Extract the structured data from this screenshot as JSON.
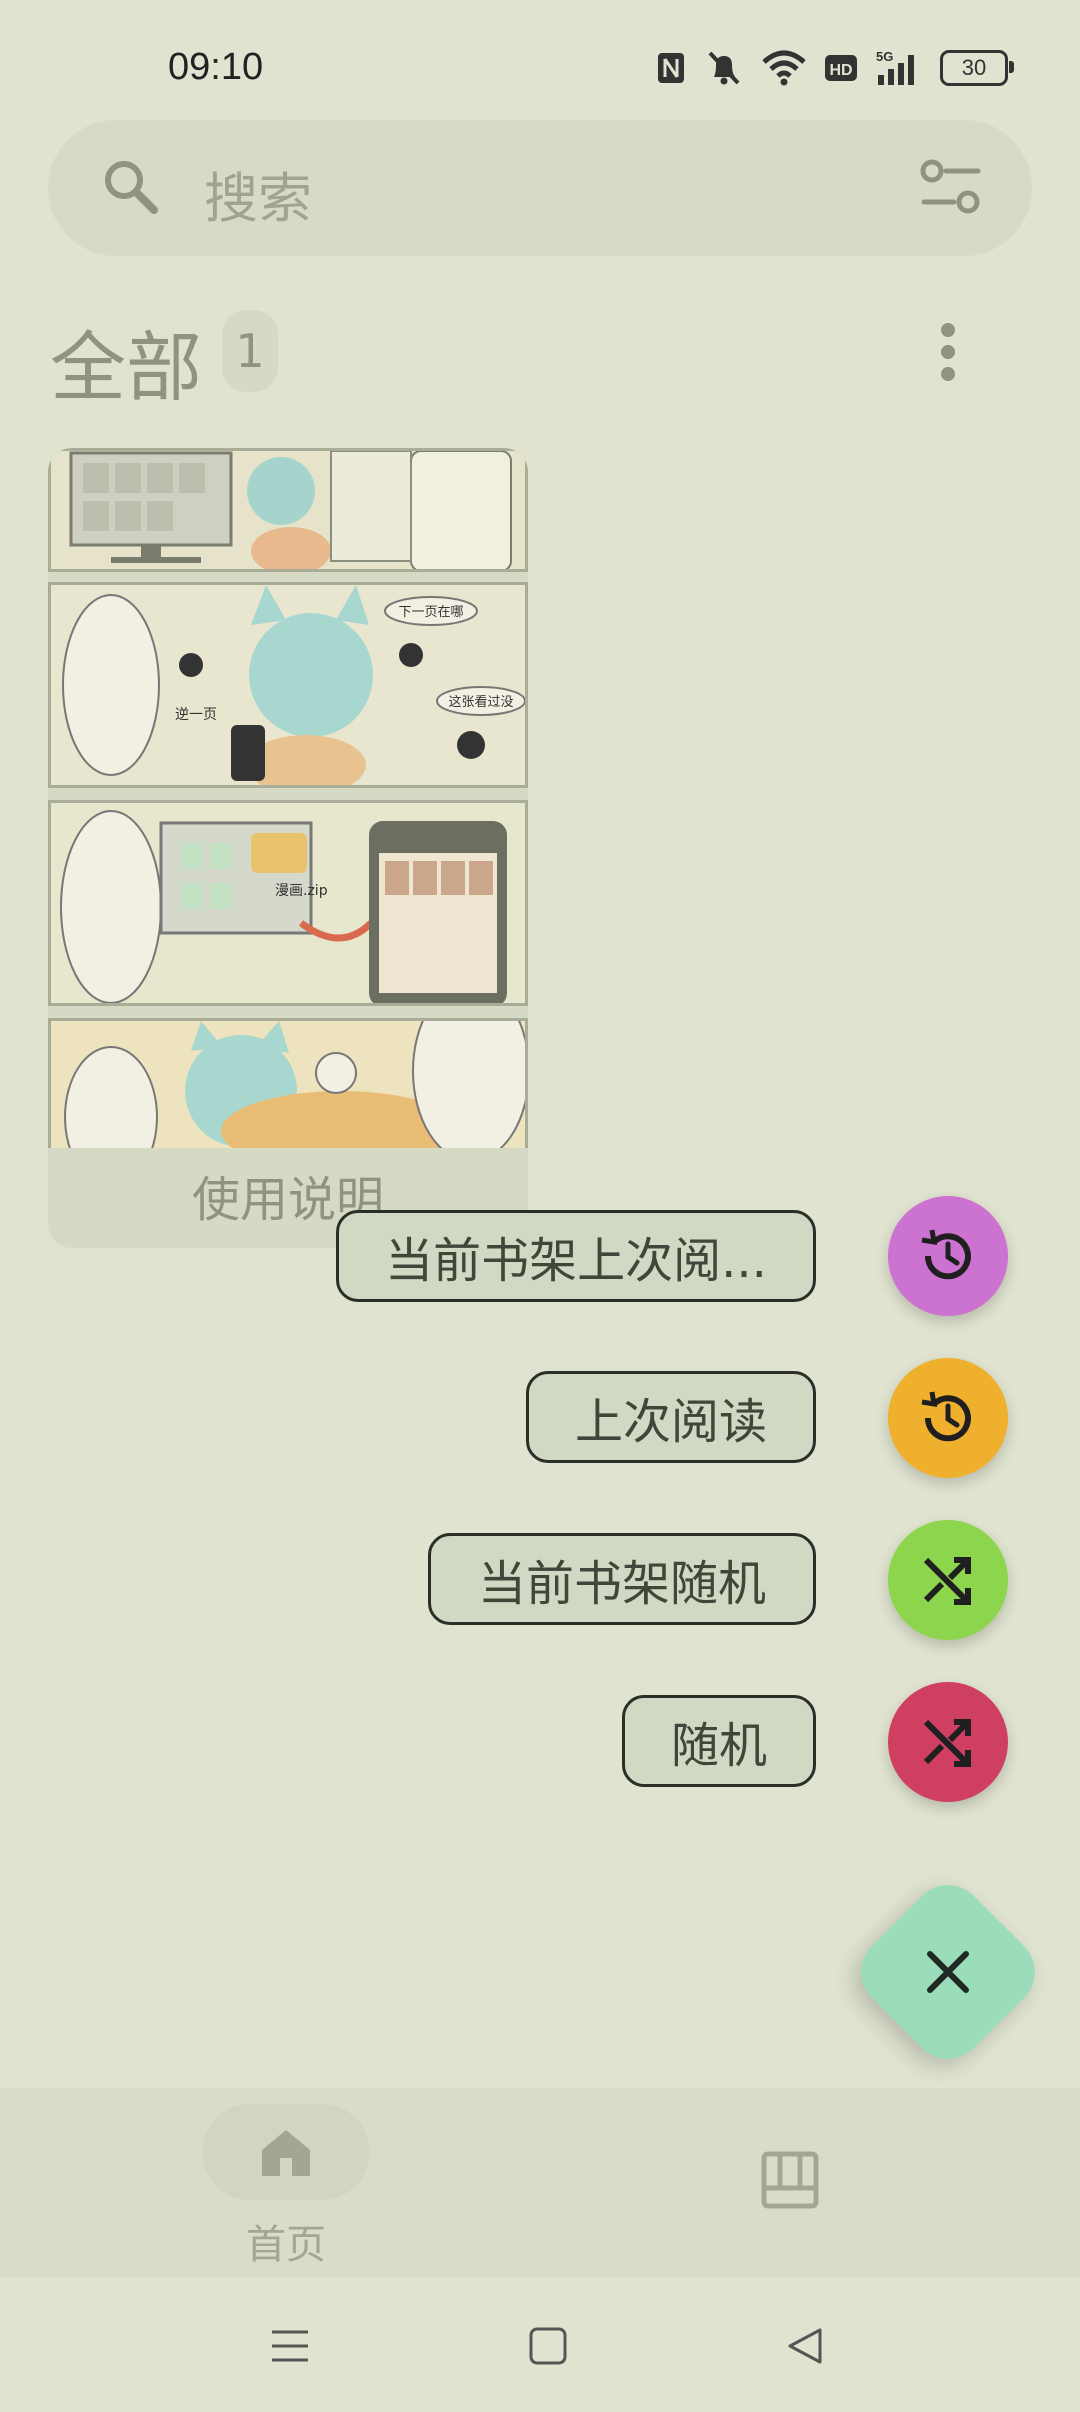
{
  "status_bar": {
    "time": "09:10",
    "battery": "30"
  },
  "search": {
    "placeholder": "搜索"
  },
  "shelf": {
    "title": "全部",
    "count": "1"
  },
  "book": {
    "title": "使用说明"
  },
  "fab_menu": {
    "items": [
      {
        "label": "当前书架上次阅...",
        "color": "#cc72d0",
        "icon": "history-icon"
      },
      {
        "label": "上次阅读",
        "color": "#efb02e",
        "icon": "history-icon"
      },
      {
        "label": "当前书架随机",
        "color": "#8cd54c",
        "icon": "shuffle-icon"
      },
      {
        "label": "随机",
        "color": "#cf3f61",
        "icon": "shuffle-icon"
      }
    ],
    "main_color": "#9bdcbb"
  },
  "bottom_nav": {
    "home_label": "首页"
  },
  "cover_texts": {
    "p2_bubble1": "下一页在哪",
    "p2_bubble2": "这张看过没",
    "p2_side": "逆一页",
    "p3_file": "漫画.zip"
  }
}
